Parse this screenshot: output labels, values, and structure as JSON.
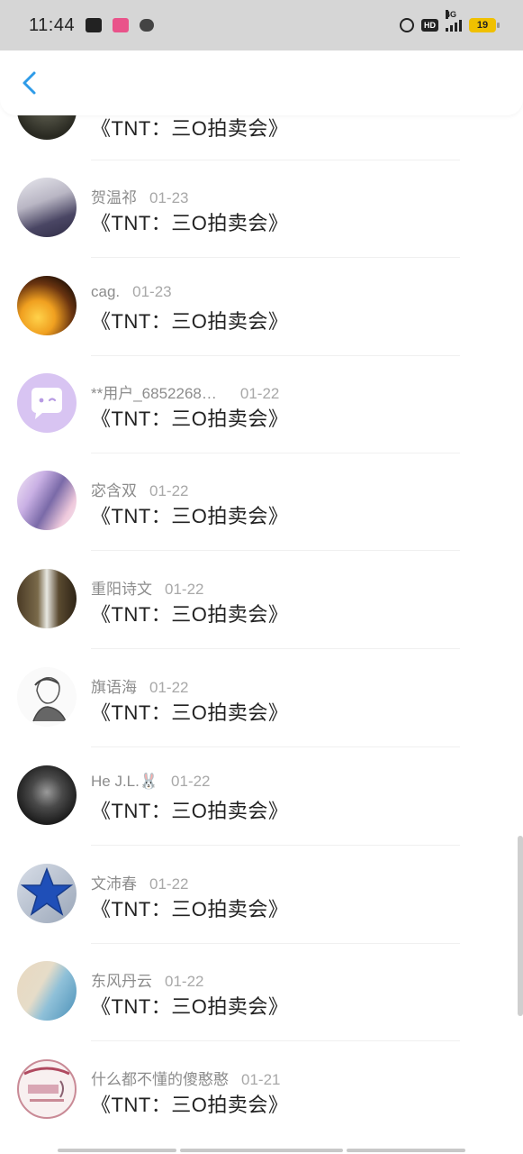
{
  "status_bar": {
    "time": "11:44",
    "network": "4G",
    "battery": "19",
    "hd": "HD"
  },
  "header": {
    "back_icon": "chevron-left-icon",
    "accent": "#2e9be8"
  },
  "items": [
    {
      "name": "",
      "date": "",
      "title": "《TNT：三O拍卖会》",
      "avatar": "photo-dark"
    },
    {
      "name": "贺温祁",
      "date": "01-23",
      "title": "《TNT：三O拍卖会》",
      "avatar": "photo-girl"
    },
    {
      "name": "cag.",
      "date": "01-23",
      "title": "《TNT：三O拍卖会》",
      "avatar": "photo-sunset"
    },
    {
      "name": "**用户_6852268…",
      "date": "01-22",
      "title": "《TNT：三O拍卖会》",
      "avatar": "default-chat"
    },
    {
      "name": "宓含双",
      "date": "01-22",
      "title": "《TNT：三O拍卖会》",
      "avatar": "anime-girls"
    },
    {
      "name": "重阳诗文",
      "date": "01-22",
      "title": "《TNT：三O拍卖会》",
      "avatar": "photo-legs"
    },
    {
      "name": "旗语海",
      "date": "01-22",
      "title": "《TNT：三O拍卖会》",
      "avatar": "sketch-boy"
    },
    {
      "name": "He J.L.🐰",
      "date": "01-22",
      "title": "《TNT：三O拍卖会》",
      "avatar": "photo-man"
    },
    {
      "name": "文沛春",
      "date": "01-22",
      "title": "《TNT：三O拍卖会》",
      "avatar": "blue-star"
    },
    {
      "name": "东风丹云",
      "date": "01-22",
      "title": "《TNT：三O拍卖会》",
      "avatar": "beach"
    },
    {
      "name": "什么都不懂的傻憨憨",
      "date": "01-21",
      "title": "《TNT：三O拍卖会》",
      "avatar": "pink-graphic"
    }
  ]
}
